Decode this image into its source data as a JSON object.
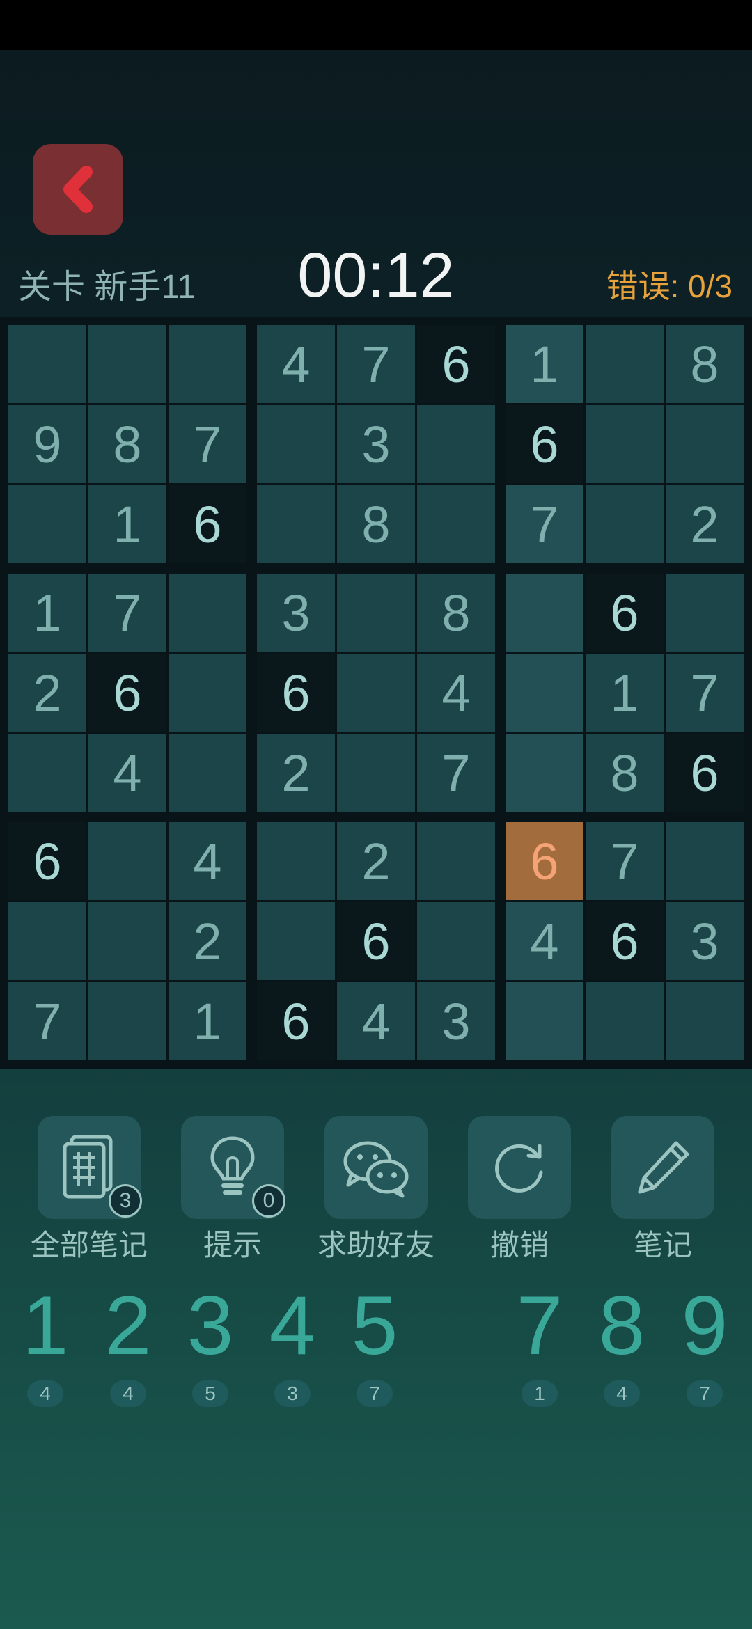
{
  "header": {
    "level": "关卡 新手11",
    "timer": "00:12",
    "errors": "错误: 0/3"
  },
  "board": {
    "rows": [
      [
        "",
        "",
        "",
        "4",
        "7",
        "6",
        "1",
        "",
        "8"
      ],
      [
        "9",
        "8",
        "7",
        "",
        "3",
        "",
        "6",
        "",
        ""
      ],
      [
        "",
        "1",
        "6",
        "",
        "8",
        "",
        "7",
        "",
        "2"
      ],
      [
        "1",
        "7",
        "",
        "3",
        "",
        "8",
        "",
        "6",
        ""
      ],
      [
        "2",
        "6",
        "",
        "6",
        "",
        "4",
        "",
        "1",
        "7"
      ],
      [
        "",
        "4",
        "",
        "2",
        "",
        "7",
        "",
        "8",
        "6"
      ],
      [
        "6",
        "",
        "4",
        "",
        "2",
        "",
        "6",
        "7",
        ""
      ],
      [
        "",
        "",
        "2",
        "",
        "6",
        "",
        "4",
        "6",
        "3"
      ],
      [
        "7",
        "",
        "1",
        "6",
        "4",
        "3",
        "",
        "",
        ""
      ]
    ],
    "selected": [
      6,
      6
    ],
    "highlighted_digit": "6"
  },
  "tools": [
    {
      "label": "全部笔记",
      "icon": "notes-grid-icon",
      "badge": "3"
    },
    {
      "label": "提示",
      "icon": "lightbulb-icon",
      "badge": "0"
    },
    {
      "label": "求助好友",
      "icon": "wechat-icon",
      "badge": ""
    },
    {
      "label": "撤销",
      "icon": "undo-icon",
      "badge": ""
    },
    {
      "label": "笔记",
      "icon": "pencil-icon",
      "badge": ""
    }
  ],
  "numpad": [
    {
      "digit": "1",
      "count": "4"
    },
    {
      "digit": "2",
      "count": "4"
    },
    {
      "digit": "3",
      "count": "5"
    },
    {
      "digit": "4",
      "count": "3"
    },
    {
      "digit": "5",
      "count": "7"
    },
    {
      "digit": "7",
      "count": "1"
    },
    {
      "digit": "8",
      "count": "4"
    },
    {
      "digit": "9",
      "count": "7"
    }
  ],
  "colors": {
    "accent": "#3aa899",
    "error": "#e7a23c",
    "selected": "#a36c3c",
    "back": "#7a2f33"
  }
}
